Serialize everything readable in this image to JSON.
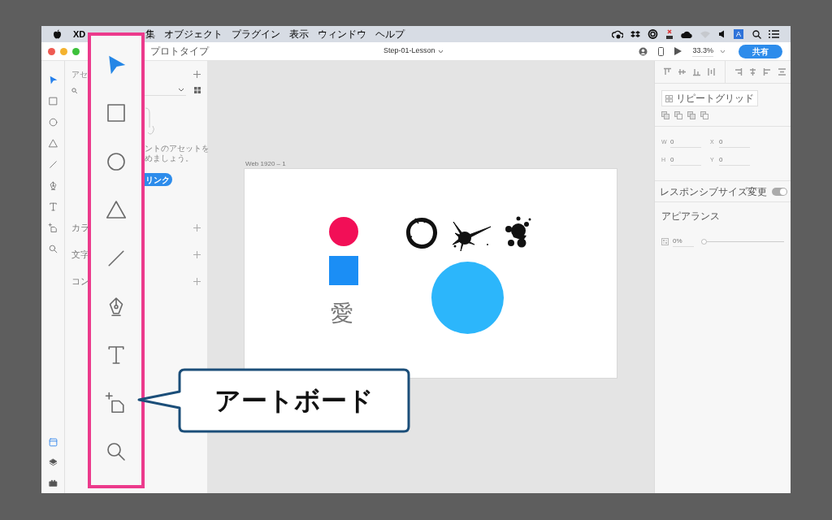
{
  "menu_bar": {
    "app": "XD",
    "items": [
      "集",
      "オブジェクト",
      "プラグイン",
      "表示",
      "ウィンドウ",
      "ヘルプ"
    ],
    "input_source": "A"
  },
  "title_bar": {
    "mode_tab": "プロトタイプ",
    "document_title": "Step-01-Lesson",
    "zoom": "33.3%",
    "share_button": "共有"
  },
  "tools": [
    {
      "kind": "select",
      "selected": true
    },
    {
      "kind": "rectangle",
      "selected": false
    },
    {
      "kind": "ellipse",
      "selected": false
    },
    {
      "kind": "triangle",
      "selected": false
    },
    {
      "kind": "line",
      "selected": false
    },
    {
      "kind": "pen",
      "selected": false
    },
    {
      "kind": "text",
      "selected": false
    },
    {
      "kind": "artboard",
      "selected": false
    },
    {
      "kind": "zoom",
      "selected": false
    }
  ],
  "panel_buttons": [
    {
      "kind": "artboards",
      "selected": true
    },
    {
      "kind": "layers",
      "selected": false
    },
    {
      "kind": "plugins",
      "selected": false
    }
  ],
  "assets_panel": {
    "title": "アセ",
    "empty_message": [
      "ントのアセットを",
      "めましょう。"
    ],
    "link_button": "リンク",
    "sections": [
      "カラ",
      "文字",
      "コン"
    ]
  },
  "canvas": {
    "artboard_label": "Web 1920 – 1",
    "glyph": "愛"
  },
  "property_panel": {
    "repeat_grid_button": "リピートグリッド",
    "fields": [
      {
        "label": "W",
        "value": "0"
      },
      {
        "label": "X",
        "value": "0"
      },
      {
        "label": "H",
        "value": "0"
      },
      {
        "label": "Y",
        "value": "0"
      }
    ],
    "responsive_resize": {
      "label": "レスポンシブサイズ変更",
      "on": true
    },
    "appearance": {
      "title": "アピアランス",
      "opacity": "0%",
      "level": 0
    }
  },
  "callout": {
    "text": "アートボード"
  }
}
